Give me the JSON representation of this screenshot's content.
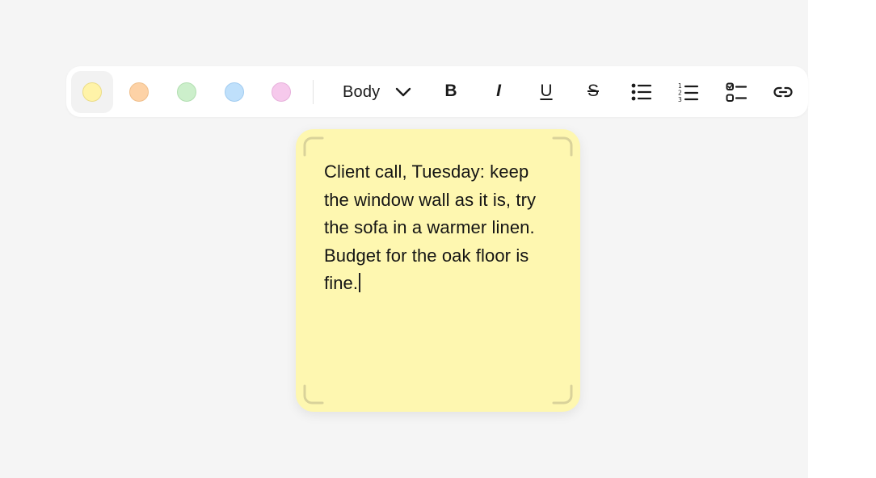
{
  "toolbar": {
    "swatches": [
      {
        "name": "yellow",
        "fill": "#fff3a8",
        "border": "#ebdc86",
        "selected": true
      },
      {
        "name": "orange",
        "fill": "#fdd2a6",
        "border": "#efbf8c",
        "selected": false
      },
      {
        "name": "green",
        "fill": "#ccefcb",
        "border": "#b2dfb1",
        "selected": false
      },
      {
        "name": "blue",
        "fill": "#bfe0fb",
        "border": "#a2ccf0",
        "selected": false
      },
      {
        "name": "pink",
        "fill": "#f6c9ec",
        "border": "#e7b1dc",
        "selected": false
      }
    ],
    "text_style": "Body",
    "bold_label": "B",
    "italic_label": "I",
    "underline_label": "U",
    "strikethrough_label": "S",
    "icons": {
      "text_style_chevron": "chevron-down-icon",
      "bulleted_list": "bulleted-list-icon",
      "numbered_list": "numbered-list-icon",
      "checklist": "checklist-icon",
      "link": "link-icon"
    }
  },
  "note": {
    "text": "Client call, Tuesday: keep the window wall as it is, try the sofa in a warmer linen. Budget for the oak floor is fine.",
    "background": "#fef7b0",
    "corner_color": "#d9d29a"
  }
}
